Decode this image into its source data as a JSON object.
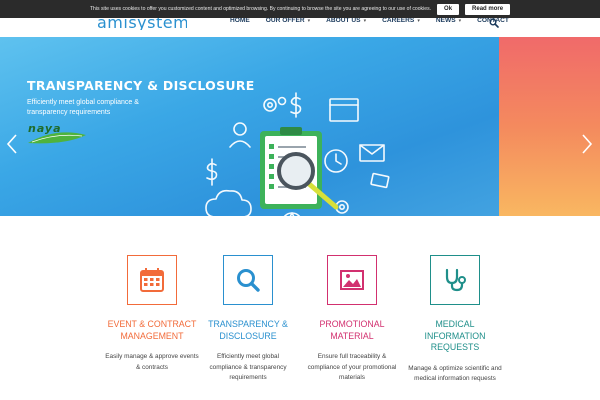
{
  "cookie": {
    "text": "This site uses cookies to offer you customized content and optimized browsing. By continuing to browse the site you are agreeing to our use of cookies.",
    "ok_label": "Ok",
    "read_more_label": "Read more"
  },
  "header": {
    "logo_text": "amisystem",
    "nav": [
      {
        "label": "HOME",
        "dropdown": false
      },
      {
        "label": "OUR OFFER",
        "dropdown": true
      },
      {
        "label": "ABOUT US",
        "dropdown": true
      },
      {
        "label": "CAREERS",
        "dropdown": true
      },
      {
        "label": "NEWS",
        "dropdown": true
      },
      {
        "label": "CONTACT",
        "dropdown": false
      }
    ],
    "search_icon": "search-icon"
  },
  "hero": {
    "title": "TRANSPARENCY & DISCLOSURE",
    "subtitle": "Efficiently meet global compliance & transparency requirements",
    "brand_text": "naya",
    "illustration_icon": "clipboard-magnifier-icon"
  },
  "features": [
    {
      "title": "EVENT & CONTRACT MANAGEMENT",
      "desc": "Easily manage & approve events & contracts",
      "color": "#f26b3a",
      "icon": "calendar-icon"
    },
    {
      "title": "TRANSPARENCY & DISCLOSURE",
      "desc": "Efficiently meet global compliance & transparency requirements",
      "color": "#2a90cf",
      "icon": "search-icon"
    },
    {
      "title": "PROMOTIONAL MATERIAL",
      "desc": "Ensure full traceability & compliance of your promotional materials",
      "color": "#d2306f",
      "icon": "image-icon"
    },
    {
      "title": "MEDICAL INFORMATION REQUESTS",
      "desc": "Manage & optimize scientific and medical information requests",
      "color": "#1f8f8a",
      "icon": "stethoscope-icon"
    }
  ],
  "colors": {
    "nav_text": "#1b3a5c",
    "hero_blue": "#3aa7e6",
    "cookie_bg": "#2b2b2b"
  }
}
